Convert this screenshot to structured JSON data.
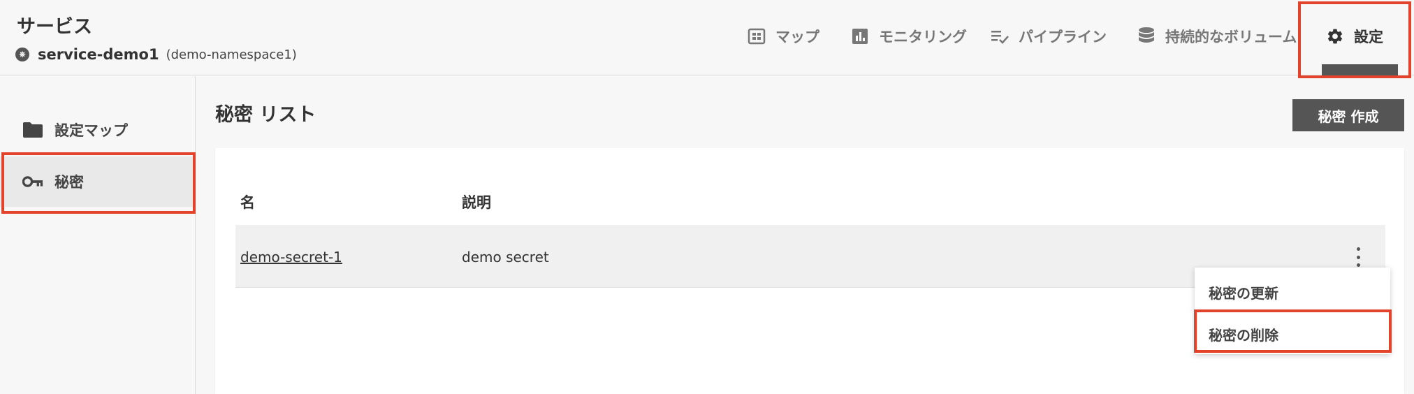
{
  "header": {
    "title": "サービス",
    "service_name": "service-demo1",
    "namespace": "(demo-namespace1)"
  },
  "nav": {
    "map": "マップ",
    "monitoring": "モニタリング",
    "pipeline": "パイプライン",
    "volume": "持続的なボリューム",
    "settings": "設定"
  },
  "sidebar": {
    "config_map": "設定マップ",
    "secret": "秘密"
  },
  "main": {
    "title": "秘密 リスト",
    "create_button": "秘密 作成",
    "columns": {
      "name": "名",
      "description": "説明"
    },
    "rows": [
      {
        "name": "demo-secret-1",
        "description": "demo secret"
      }
    ]
  },
  "menu": {
    "update": "秘密の更新",
    "delete": "秘密の削除"
  },
  "colors": {
    "highlight": "#e2432a",
    "dark": "#555555",
    "background": "#f7f7f7"
  }
}
